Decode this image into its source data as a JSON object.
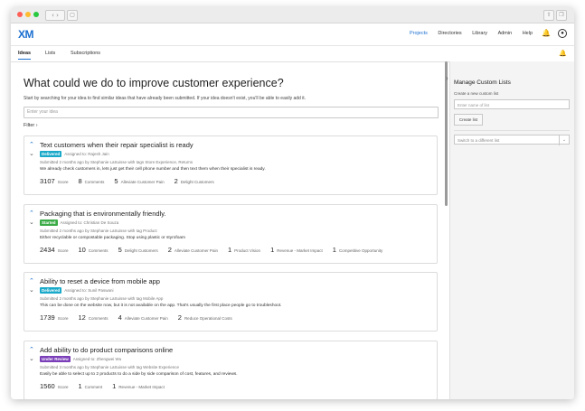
{
  "nav": {
    "logo": "XM",
    "links": [
      "Projects",
      "Directories",
      "Library",
      "Admin",
      "Help"
    ]
  },
  "tabs": [
    "Ideas",
    "Lists",
    "Subscriptions"
  ],
  "main": {
    "title": "What could we do to improve customer experience?",
    "intro": "Start by searching for your idea to find similar ideas that have already been submitted. If your idea doesn't exist, you'll be able to easily add it.",
    "search_placeholder": "Enter your idea",
    "filter_label": "Filter"
  },
  "ideas": [
    {
      "title": "Text customers when their repair specialist is ready",
      "status": "Delivered",
      "status_color": "#1aa9c9",
      "assigned": "Assigned to: Rajesh Jain",
      "meta": "Submitted 2 months ago by Stephanie LaSuisse with tags Store Experience, Returns",
      "desc": "We already check customers in, lets just get their cell phone number and then text them when their specialist is ready.",
      "stats": [
        {
          "value": "3107",
          "label": "Score"
        },
        {
          "value": "8",
          "label": "Comments"
        },
        {
          "value": "5",
          "label": "Alleviate Customer Pain"
        },
        {
          "value": "2",
          "label": "Delight Customers"
        }
      ]
    },
    {
      "title": "Packaging that is environmentally friendly.",
      "status": "Started",
      "status_color": "#3bab47",
      "assigned": "Assigned to: Christian De Souza",
      "meta": "Submitted 2 months ago by Stephanie LaSuisse with tag Product",
      "desc": "Either recyclable or compostable packaging. Stop using plastic or styrofoam",
      "stats": [
        {
          "value": "2434",
          "label": "Score"
        },
        {
          "value": "10",
          "label": "Comments"
        },
        {
          "value": "5",
          "label": "Delight Customers"
        },
        {
          "value": "2",
          "label": "Alleviate Customer Pain"
        },
        {
          "value": "1",
          "label": "Product Vision"
        },
        {
          "value": "1",
          "label": "Revenue - Market Impact"
        },
        {
          "value": "1",
          "label": "Competitive Opportunity"
        }
      ]
    },
    {
      "title": "Ability to reset a device from mobile app",
      "status": "Delivered",
      "status_color": "#1aa9c9",
      "assigned": "Assigned to: Sunil Paswani",
      "meta": "Submitted 2 months ago by Stephanie LaSuisse with tag Mobile App",
      "desc": "This can be done on the website now, but it is not available on the app. That's usually the first place people go to troubleshoot.",
      "stats": [
        {
          "value": "1739",
          "label": "Score"
        },
        {
          "value": "12",
          "label": "Comments"
        },
        {
          "value": "4",
          "label": "Alleviate Customer Pain"
        },
        {
          "value": "2",
          "label": "Reduce Operational Costs"
        }
      ]
    },
    {
      "title": "Add ability to do product comparisons online",
      "status": "Under Review",
      "status_color": "#7a3fb8",
      "assigned": "Assigned to: Zhengwei Wu",
      "meta": "Submitted 3 months ago by Stephanie LaSuisse with tag Website Experience",
      "desc": "Easily be able to select up to 2 products to do a side by side comparison of cost, features, and reviews.",
      "stats": [
        {
          "value": "1560",
          "label": "Score"
        },
        {
          "value": "1",
          "label": "Comment"
        },
        {
          "value": "1",
          "label": "Revenue - Market Impact"
        }
      ]
    }
  ],
  "panel": {
    "title": "Manage Custom Lists",
    "subtitle": "Create a new custom list",
    "input_placeholder": "Enter name of list",
    "create_label": "Create list",
    "select_label": "Switch to a different list"
  }
}
